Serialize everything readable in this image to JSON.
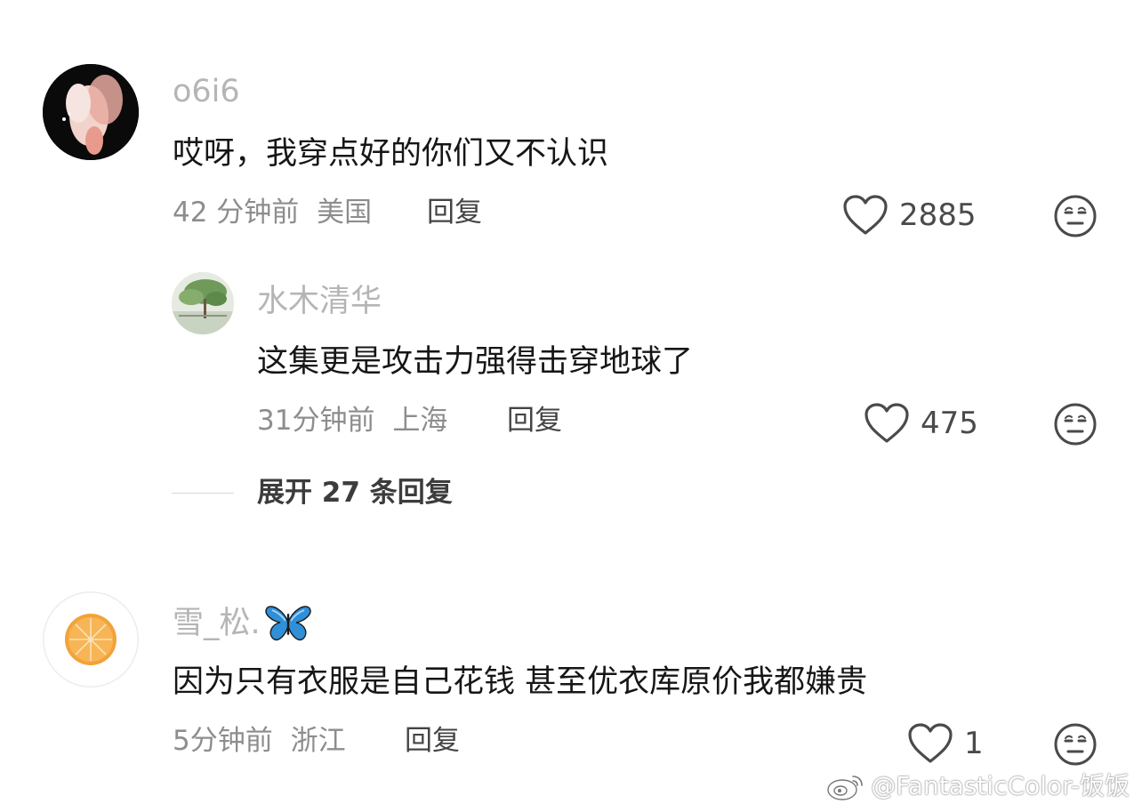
{
  "comments": [
    {
      "username": "o6i6",
      "content": "哎呀，我穿点好的你们又不认识",
      "time": "42 分钟前",
      "location": "美国",
      "reply_label": "回复",
      "likes": "2885",
      "replies": [
        {
          "username": "水木清华",
          "content": "这集更是攻击力强得击穿地球了",
          "time": "31分钟前",
          "location": "上海",
          "reply_label": "回复",
          "likes": "475"
        }
      ],
      "expand_label": "展开 27 条回复"
    },
    {
      "username": "雪_松.",
      "content": "因为只有衣服是自己花钱 甚至优衣库原价我都嫌贵",
      "time": "5分钟前",
      "location": "浙江",
      "reply_label": "回复",
      "likes": "1"
    }
  ],
  "watermark": "@FantasticColor-饭饭",
  "colors": {
    "username": "#b5b5b5",
    "content": "#161616",
    "meta": "#8d8d8d",
    "icon": "#4a4a4a"
  },
  "icons": {
    "like": "heart-outline-icon",
    "dislike": "unamused-face-icon",
    "butterfly": "butterfly-icon",
    "weibo": "weibo-logo-icon"
  }
}
